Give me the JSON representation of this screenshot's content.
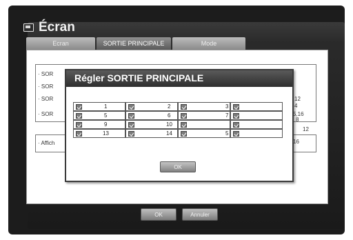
{
  "window": {
    "title": "Écran",
    "icon": "monitor-icon"
  },
  "tabs": [
    {
      "label": "Ecran",
      "active": false
    },
    {
      "label": "SORTIE PRINCIPALE",
      "active": true
    },
    {
      "label": "Mode",
      "active": false
    }
  ],
  "content": {
    "rows": [
      {
        "label": "· SOR"
      },
      {
        "label": "· SOR"
      },
      {
        "label": "· SOR"
      },
      {
        "label": "· SOR"
      }
    ],
    "affich_label": "· Affich",
    "right_values": [
      "12",
      "4",
      "8",
      "5,16",
      "12",
      "16"
    ]
  },
  "footer": {
    "ok_label": "OK",
    "cancel_label": "Annuler"
  },
  "dialog": {
    "title": "Régler SORTIE PRINCIPALE",
    "ok_label": "OK",
    "rows": [
      [
        "1",
        "2",
        "3",
        ""
      ],
      [
        "5",
        "6",
        "7",
        ""
      ],
      [
        "9",
        "10",
        "",
        ""
      ],
      [
        "13",
        "14",
        "5",
        ""
      ]
    ]
  },
  "colors": {
    "checkbox": "#7a7a7a",
    "frame": "#1c1c1c",
    "header": "#2e2e2e"
  }
}
